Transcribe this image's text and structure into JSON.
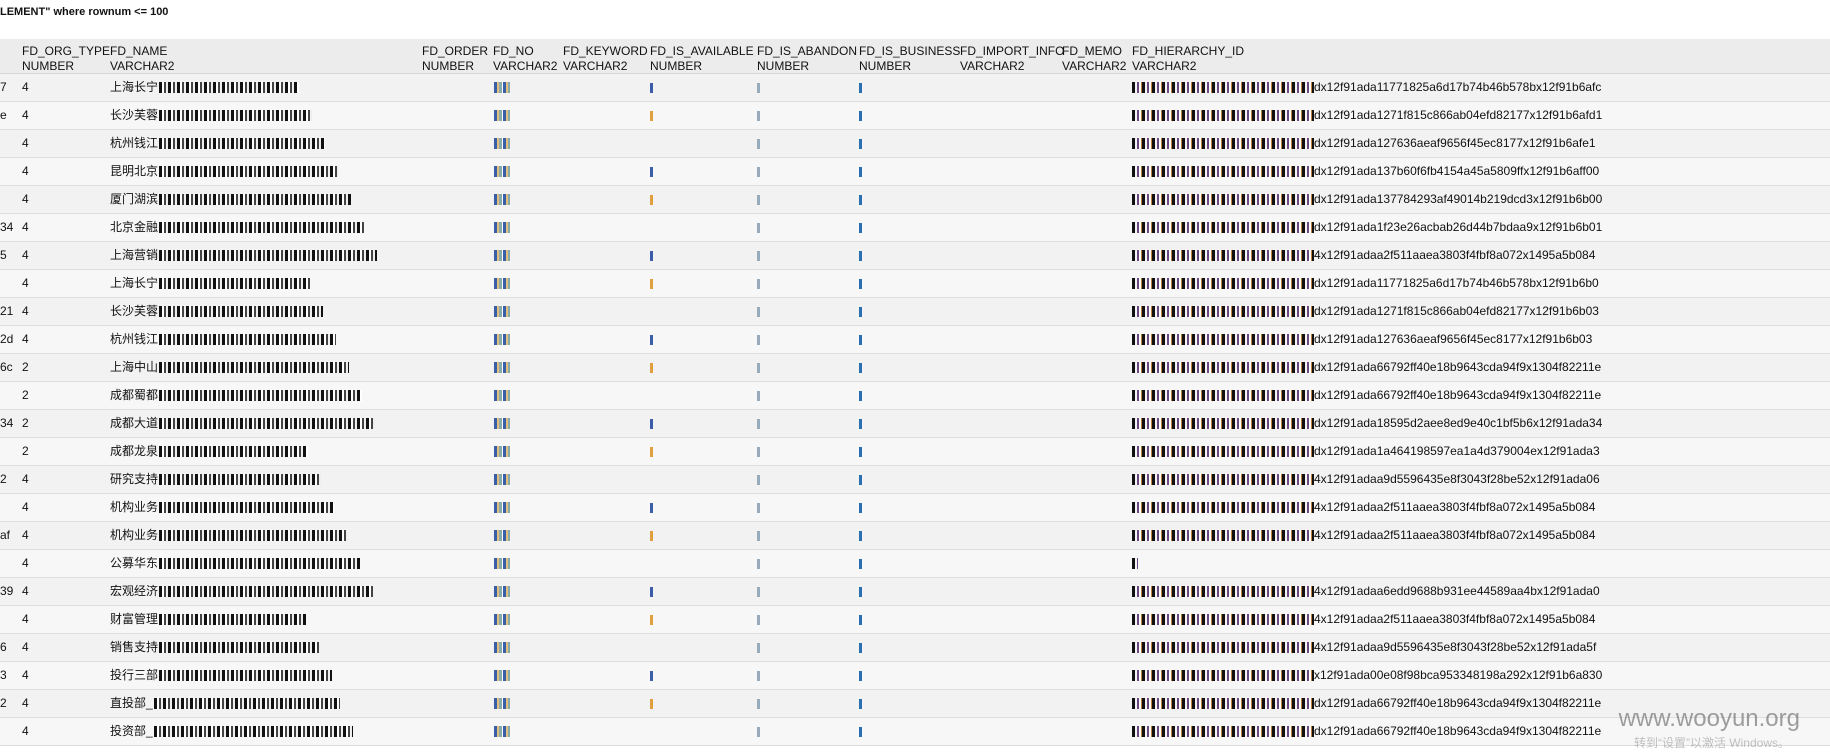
{
  "query_fragment": "LEMENT\" where rownum <= 100",
  "columns": [
    {
      "name": "FD_ORG_TYPE",
      "type": "NUMBER"
    },
    {
      "name": "FD_NAME",
      "type": "VARCHAR2"
    },
    {
      "name": "FD_ORDER",
      "type": "NUMBER"
    },
    {
      "name": "FD_NO",
      "type": "VARCHAR2"
    },
    {
      "name": "FD_KEYWORD",
      "type": "VARCHAR2"
    },
    {
      "name": "FD_IS_AVAILABLE",
      "type": "NUMBER"
    },
    {
      "name": "FD_IS_ABANDON",
      "type": "NUMBER"
    },
    {
      "name": "FD_IS_BUSINESS",
      "type": "NUMBER"
    },
    {
      "name": "FD_IMPORT_INFO",
      "type": "VARCHAR2"
    },
    {
      "name": "FD_MEMO",
      "type": "VARCHAR2"
    },
    {
      "name": "FD_HIERARCHY_ID",
      "type": "VARCHAR2"
    }
  ],
  "rows": [
    {
      "id": "7",
      "org": "4",
      "name": "上海长宁",
      "hier": "dx12f91ada11771825a6d17b74b46b578bx12f91b6afc"
    },
    {
      "id": "e",
      "org": "4",
      "name": "长沙芙蓉",
      "hier": "dx12f91ada1271f815c866ab04efd82177x12f91b6afd1"
    },
    {
      "id": "",
      "org": "4",
      "name": "杭州钱江",
      "hier": "dx12f91ada127636aeaf9656f45ec8177x12f91b6afe1"
    },
    {
      "id": "",
      "org": "4",
      "name": "昆明北京",
      "hier": "dx12f91ada137b60f6fb4154a45a5809ffx12f91b6aff00"
    },
    {
      "id": "",
      "org": "4",
      "name": "厦门湖滨",
      "hier": "dx12f91ada137784293af49014b219dcd3x12f91b6b00"
    },
    {
      "id": "34",
      "org": "4",
      "name": "北京金融",
      "hier": "dx12f91ada1f23e26acbab26d44b7bdaa9x12f91b6b01"
    },
    {
      "id": "5",
      "org": "4",
      "name": "上海营销",
      "hier": "4x12f91adaa2f511aaea3803f4fbf8a072x1495a5b084"
    },
    {
      "id": "",
      "org": "4",
      "name": "上海长宁",
      "hier": "dx12f91ada11771825a6d17b74b46b578bx12f91b6b0"
    },
    {
      "id": "21",
      "org": "4",
      "name": "长沙芙蓉",
      "hier": "dx12f91ada1271f815c866ab04efd82177x12f91b6b03"
    },
    {
      "id": "2d",
      "org": "4",
      "name": "杭州钱江",
      "hier": "dx12f91ada127636aeaf9656f45ec8177x12f91b6b03"
    },
    {
      "id": "6c",
      "org": "2",
      "name": "上海中山",
      "hier": "dx12f91ada66792ff40e18b9643cda94f9x1304f82211e"
    },
    {
      "id": "",
      "org": "2",
      "name": "成都蜀都",
      "hier": "dx12f91ada66792ff40e18b9643cda94f9x1304f82211e"
    },
    {
      "id": "34",
      "org": "2",
      "name": "成都大道",
      "hier": "dx12f91ada18595d2aee8ed9e40c1bf5b6x12f91ada34"
    },
    {
      "id": "",
      "org": "2",
      "name": "成都龙泉",
      "hier": "dx12f91ada1a464198597ea1a4d379004ex12f91ada3"
    },
    {
      "id": "2",
      "org": "4",
      "name": "研究支持",
      "hier": "4x12f91adaa9d5596435e8f3043f28be52x12f91ada06"
    },
    {
      "id": "",
      "org": "4",
      "name": "机构业务",
      "hier": "4x12f91adaa2f511aaea3803f4fbf8a072x1495a5b084"
    },
    {
      "id": "af",
      "org": "4",
      "name": "机构业务",
      "hier": "4x12f91adaa2f511aaea3803f4fbf8a072x1495a5b084"
    },
    {
      "id": "",
      "org": "4",
      "name": "公募华东",
      "hier": ""
    },
    {
      "id": "39",
      "org": "4",
      "name": "宏观经济",
      "hier": "4x12f91adaa6edd9688b931ee44589aa4bx12f91ada0"
    },
    {
      "id": "",
      "org": "4",
      "name": "财富管理",
      "hier": "4x12f91adaa2f511aaea3803f4fbf8a072x1495a5b084"
    },
    {
      "id": "6",
      "org": "4",
      "name": "销售支持",
      "hier": "4x12f91adaa9d5596435e8f3043f28be52x12f91ada5f"
    },
    {
      "id": "3",
      "org": "4",
      "name": "投行三部",
      "hier": "x12f91ada00e08f98bca953348198a292x12f91b6a830"
    },
    {
      "id": "2",
      "org": "4",
      "name": "直投部_",
      "hier": "dx12f91ada66792ff40e18b9643cda94f9x1304f82211e"
    },
    {
      "id": "",
      "org": "4",
      "name": "投资部_",
      "hier": "dx12f91ada66792ff40e18b9643cda94f9x1304f82211e"
    }
  ],
  "watermark": "www.wooyun.org",
  "watermark_sub": "转到“设置”以激活 Windows。"
}
